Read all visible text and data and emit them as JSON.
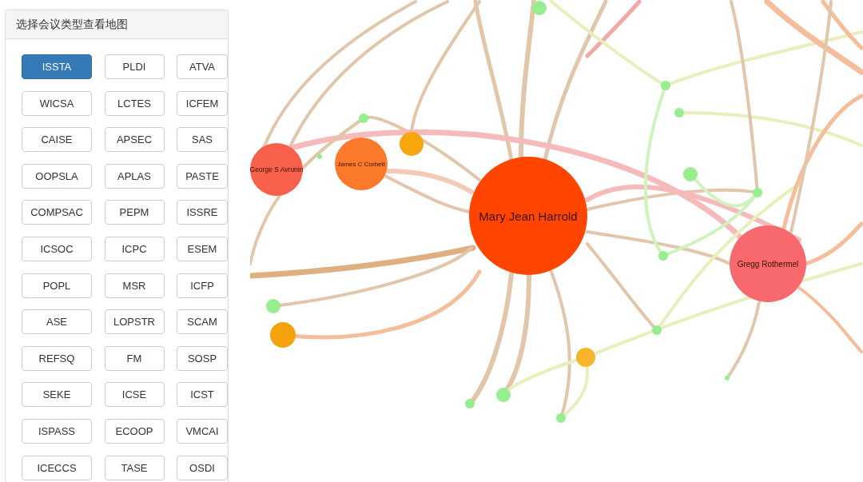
{
  "panel": {
    "title": "选择会议类型查看地图",
    "buttons": [
      {
        "label": "ISSTA",
        "selected": true
      },
      {
        "label": "PLDI",
        "selected": false
      },
      {
        "label": "ATVA",
        "selected": false
      },
      {
        "label": "WICSA",
        "selected": false
      },
      {
        "label": "LCTES",
        "selected": false
      },
      {
        "label": "ICFEM",
        "selected": false
      },
      {
        "label": "CAISE",
        "selected": false
      },
      {
        "label": "APSEC",
        "selected": false
      },
      {
        "label": "SAS",
        "selected": false
      },
      {
        "label": "OOPSLA",
        "selected": false
      },
      {
        "label": "APLAS",
        "selected": false
      },
      {
        "label": "PASTE",
        "selected": false
      },
      {
        "label": "COMPSAC",
        "selected": false
      },
      {
        "label": "PEPM",
        "selected": false
      },
      {
        "label": "ISSRE",
        "selected": false
      },
      {
        "label": "ICSOC",
        "selected": false
      },
      {
        "label": "ICPC",
        "selected": false
      },
      {
        "label": "ESEM",
        "selected": false
      },
      {
        "label": "POPL",
        "selected": false
      },
      {
        "label": "MSR",
        "selected": false
      },
      {
        "label": "ICFP",
        "selected": false
      },
      {
        "label": "ASE",
        "selected": false
      },
      {
        "label": "LOPSTR",
        "selected": false
      },
      {
        "label": "SCAM",
        "selected": false
      },
      {
        "label": "REFSQ",
        "selected": false
      },
      {
        "label": "FM",
        "selected": false
      },
      {
        "label": "SOSP",
        "selected": false
      },
      {
        "label": "SEKE",
        "selected": false
      },
      {
        "label": "ICSE",
        "selected": false
      },
      {
        "label": "ICST",
        "selected": false
      },
      {
        "label": "ISPASS",
        "selected": false
      },
      {
        "label": "ECOOP",
        "selected": false
      },
      {
        "label": "VMCAI",
        "selected": false
      },
      {
        "label": "ICECCS",
        "selected": false
      },
      {
        "label": "TASE",
        "selected": false
      },
      {
        "label": "OSDI",
        "selected": false
      }
    ]
  },
  "graph": {
    "nodes": [
      {
        "label": "Mary Jean Harrold",
        "color": "#ff4500"
      },
      {
        "label": "Gregg Rothermel",
        "color": "#f7696d"
      },
      {
        "label": "George S Avrunin",
        "color": "#f7604a"
      },
      {
        "label": "James C Corbett",
        "color": "#fb7a2c"
      },
      {
        "color": "#f8a60e"
      },
      {
        "color": "#f6a20c"
      },
      {
        "color": "#f8b42a"
      },
      {
        "color": "#95ef8f"
      },
      {
        "color": "#95ef8f"
      },
      {
        "color": "#95ef8f"
      },
      {
        "color": "#95ef8f"
      },
      {
        "color": "#95ef8f"
      },
      {
        "color": "#95ef8f"
      },
      {
        "color": "#95ef8f"
      },
      {
        "color": "#95ef8f"
      },
      {
        "color": "#95ef8f"
      },
      {
        "color": "#95ef8f"
      },
      {
        "color": "#95ef8f"
      },
      {
        "color": "#95ef8f"
      },
      {
        "color": "#95ef8f"
      },
      {
        "color": "#95ef8f"
      }
    ]
  }
}
